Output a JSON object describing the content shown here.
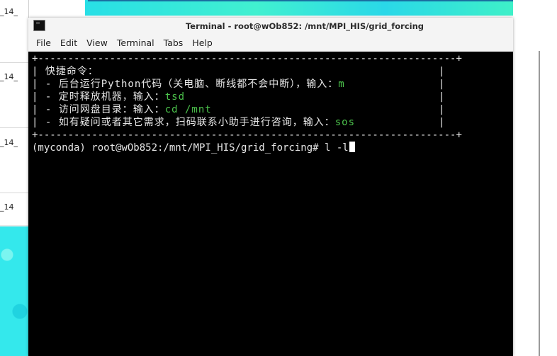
{
  "background": {
    "left_labels": [
      "_14_",
      "_14_",
      "_14_",
      "_14"
    ],
    "accent_color": "#34e8ec"
  },
  "window": {
    "title": "Terminal - root@wOb852: /mnt/MPI_HIS/grid_forcing",
    "icon": "terminal-icon"
  },
  "menu": {
    "items": [
      "File",
      "Edit",
      "View",
      "Terminal",
      "Tabs",
      "Help"
    ]
  },
  "terminal": {
    "border_line": "+----------------------------------------------------------------------+",
    "header": "| 快捷命令：",
    "commands": [
      {
        "prefix": "| - 后台运行Python代码（关电脑、断线都不会中断），输入：",
        "value": "m"
      },
      {
        "prefix": "| - 定时释放机器，输入：",
        "value": "tsd"
      },
      {
        "prefix": "| - 访问网盘目录：输入：",
        "value": "cd /mnt"
      },
      {
        "prefix": "| - 如有疑问或者其它需求，扫码联系小助手进行咨询，输入：",
        "value": "sos"
      }
    ],
    "prompt": "(myconda) root@wOb852:/mnt/MPI_HIS/grid_forcing# ",
    "input": "l -l",
    "colors": {
      "background": "#000000",
      "text": "#e6e6e6",
      "highlight": "#4cc34c"
    }
  }
}
